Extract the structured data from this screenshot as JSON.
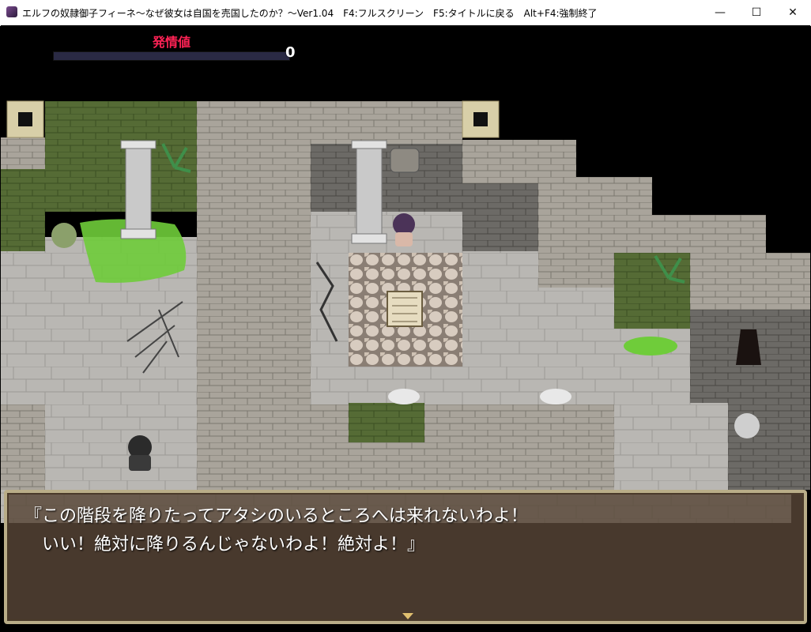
{
  "window": {
    "title": "エルフの奴隷御子フィーネ～なぜ彼女は自国を売国したのか？～Ver1.04　F4:フルスクリーン　F5:タイトルに戻る　Alt+F4:強制終了",
    "minimize_label": "—",
    "maximize_label": "☐",
    "close_label": "✕"
  },
  "hud": {
    "label": "発情値",
    "value": "0",
    "level_fraction": 0
  },
  "message": {
    "line1": "『この階段を降りたってアタシのいるところへは来れないわよ！",
    "line2": "　いい！絶対に降りるんじゃないわよ！絶対よ！』"
  },
  "colors": {
    "wall_light": "#a9a49b",
    "floor": "#b8b6b2",
    "moss": "#4f6b2f",
    "grass": "#6fcc3a"
  }
}
